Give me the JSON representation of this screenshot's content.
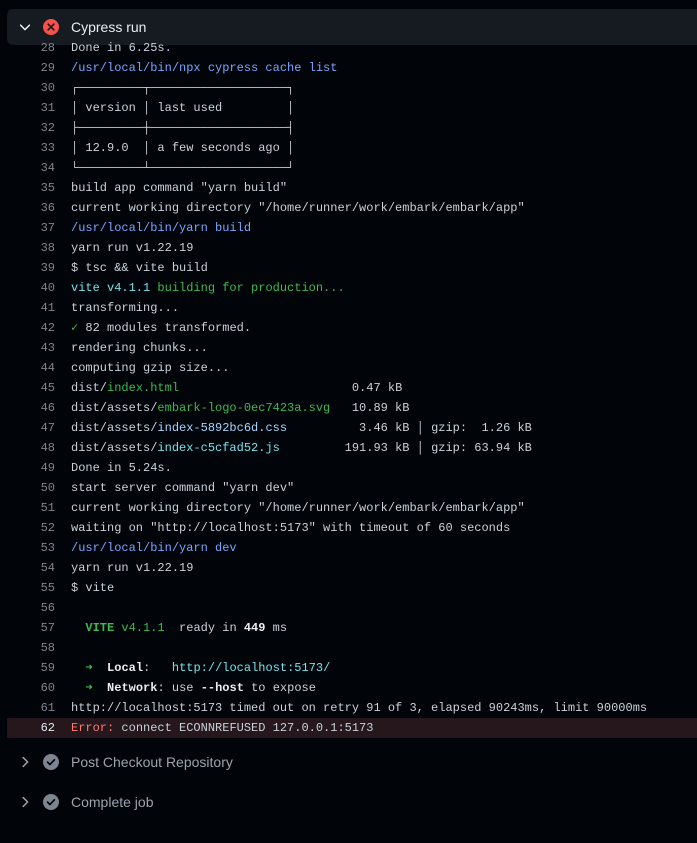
{
  "step": {
    "title": "Cypress run",
    "status": "failed"
  },
  "lines": [
    {
      "n": "28",
      "parts": [
        {
          "t": "Done in 6.25s.",
          "c": "plain"
        }
      ]
    },
    {
      "n": "29",
      "parts": [
        {
          "t": "/usr/local/bin/npx cypress cache list",
          "c": "blue"
        }
      ]
    },
    {
      "n": "30",
      "parts": [
        {
          "t": "┌─────────┬───────────────────┐",
          "c": "plain"
        }
      ]
    },
    {
      "n": "31",
      "parts": [
        {
          "t": "│ version │ last used         │",
          "c": "plain"
        }
      ]
    },
    {
      "n": "32",
      "parts": [
        {
          "t": "├─────────┼───────────────────┤",
          "c": "plain"
        }
      ]
    },
    {
      "n": "33",
      "parts": [
        {
          "t": "│ 12.9.0  │ a few seconds ago │",
          "c": "plain"
        }
      ]
    },
    {
      "n": "34",
      "parts": [
        {
          "t": "└─────────┴───────────────────┘",
          "c": "plain"
        }
      ]
    },
    {
      "n": "35",
      "parts": [
        {
          "t": "build app command \"yarn build\"",
          "c": "plain"
        }
      ]
    },
    {
      "n": "36",
      "parts": [
        {
          "t": "current working directory \"/home/runner/work/embark/embark/app\"",
          "c": "plain"
        }
      ]
    },
    {
      "n": "37",
      "parts": [
        {
          "t": "/usr/local/bin/yarn build",
          "c": "blue"
        }
      ]
    },
    {
      "n": "38",
      "parts": [
        {
          "t": "yarn run v1.22.19",
          "c": "plain"
        }
      ]
    },
    {
      "n": "39",
      "parts": [
        {
          "t": "$ tsc && vite build",
          "c": "plain"
        }
      ]
    },
    {
      "n": "40",
      "parts": [
        {
          "t": "vite v4.1.1",
          "c": "cyan"
        },
        {
          "t": " building for production...",
          "c": "green"
        }
      ]
    },
    {
      "n": "41",
      "parts": [
        {
          "t": "transforming...",
          "c": "plain"
        }
      ]
    },
    {
      "n": "42",
      "parts": [
        {
          "t": "✓",
          "c": "green"
        },
        {
          "t": " 82 modules transformed.",
          "c": "plain"
        }
      ]
    },
    {
      "n": "43",
      "parts": [
        {
          "t": "rendering chunks...",
          "c": "plain"
        }
      ]
    },
    {
      "n": "44",
      "parts": [
        {
          "t": "computing gzip size...",
          "c": "plain"
        }
      ]
    },
    {
      "n": "45",
      "parts": [
        {
          "t": "dist/",
          "c": "plain"
        },
        {
          "t": "index.html",
          "c": "green"
        },
        {
          "t": "                        0.47 kB",
          "c": "plain"
        }
      ]
    },
    {
      "n": "46",
      "parts": [
        {
          "t": "dist/assets/",
          "c": "plain"
        },
        {
          "t": "embark-logo-0ec7423a.svg",
          "c": "green"
        },
        {
          "t": "   10.89 kB",
          "c": "plain"
        }
      ]
    },
    {
      "n": "47",
      "parts": [
        {
          "t": "dist/assets/",
          "c": "plain"
        },
        {
          "t": "index-5892bc6d.css",
          "c": "link"
        },
        {
          "t": "          3.46 kB │ gzip:  1.26 kB",
          "c": "plain"
        }
      ]
    },
    {
      "n": "48",
      "parts": [
        {
          "t": "dist/assets/",
          "c": "plain"
        },
        {
          "t": "index-c5cfad52.js",
          "c": "cyan"
        },
        {
          "t": "         191.93 kB │ gzip: 63.94 kB",
          "c": "plain"
        }
      ]
    },
    {
      "n": "49",
      "parts": [
        {
          "t": "Done in 5.24s.",
          "c": "plain"
        }
      ]
    },
    {
      "n": "50",
      "parts": [
        {
          "t": "start server command \"yarn dev\"",
          "c": "plain"
        }
      ]
    },
    {
      "n": "51",
      "parts": [
        {
          "t": "current working directory \"/home/runner/work/embark/embark/app\"",
          "c": "plain"
        }
      ]
    },
    {
      "n": "52",
      "parts": [
        {
          "t": "waiting on \"http://localhost:5173\" with timeout of 60 seconds",
          "c": "plain"
        }
      ]
    },
    {
      "n": "53",
      "parts": [
        {
          "t": "/usr/local/bin/yarn dev",
          "c": "blue"
        }
      ]
    },
    {
      "n": "54",
      "parts": [
        {
          "t": "yarn run v1.22.19",
          "c": "plain"
        }
      ]
    },
    {
      "n": "55",
      "parts": [
        {
          "t": "$ vite",
          "c": "plain"
        }
      ]
    },
    {
      "n": "56",
      "parts": []
    },
    {
      "n": "57",
      "parts": [
        {
          "t": "  ",
          "c": "plain"
        },
        {
          "t": "VITE",
          "c": "bold-green"
        },
        {
          "t": " v4.1.1",
          "c": "green"
        },
        {
          "t": "  ready in ",
          "c": "plain"
        },
        {
          "t": "449",
          "c": "bold"
        },
        {
          "t": " ms",
          "c": "plain"
        }
      ]
    },
    {
      "n": "58",
      "parts": []
    },
    {
      "n": "59",
      "parts": [
        {
          "t": "  ➜",
          "c": "green"
        },
        {
          "t": "  ",
          "c": "plain"
        },
        {
          "t": "Local",
          "c": "bold"
        },
        {
          "t": ":   ",
          "c": "plain"
        },
        {
          "t": "http://localhost:",
          "c": "cyan"
        },
        {
          "t": "5173",
          "c": "cyan"
        },
        {
          "t": "/",
          "c": "cyan"
        }
      ]
    },
    {
      "n": "60",
      "parts": [
        {
          "t": "  ➜",
          "c": "green"
        },
        {
          "t": "  ",
          "c": "plain"
        },
        {
          "t": "Network",
          "c": "bold"
        },
        {
          "t": ": use ",
          "c": "plain"
        },
        {
          "t": "--host",
          "c": "bold"
        },
        {
          "t": " to expose",
          "c": "plain"
        }
      ]
    },
    {
      "n": "61",
      "parts": [
        {
          "t": "http://localhost:5173 timed out on retry 91 of 3, elapsed 90243ms, limit 90000ms",
          "c": "plain"
        }
      ]
    },
    {
      "n": "62",
      "error": true,
      "parts": [
        {
          "t": "Error:",
          "c": "red"
        },
        {
          "t": " connect ECONNREFUSED 127.0.0.1:5173",
          "c": "plain"
        }
      ]
    }
  ],
  "other_steps": [
    {
      "title": "Post Checkout Repository",
      "status": "success"
    },
    {
      "title": "Complete job",
      "status": "success"
    }
  ],
  "colors": {
    "error": "#f85149",
    "success": "#7d8590",
    "link": "#79a6ff"
  }
}
